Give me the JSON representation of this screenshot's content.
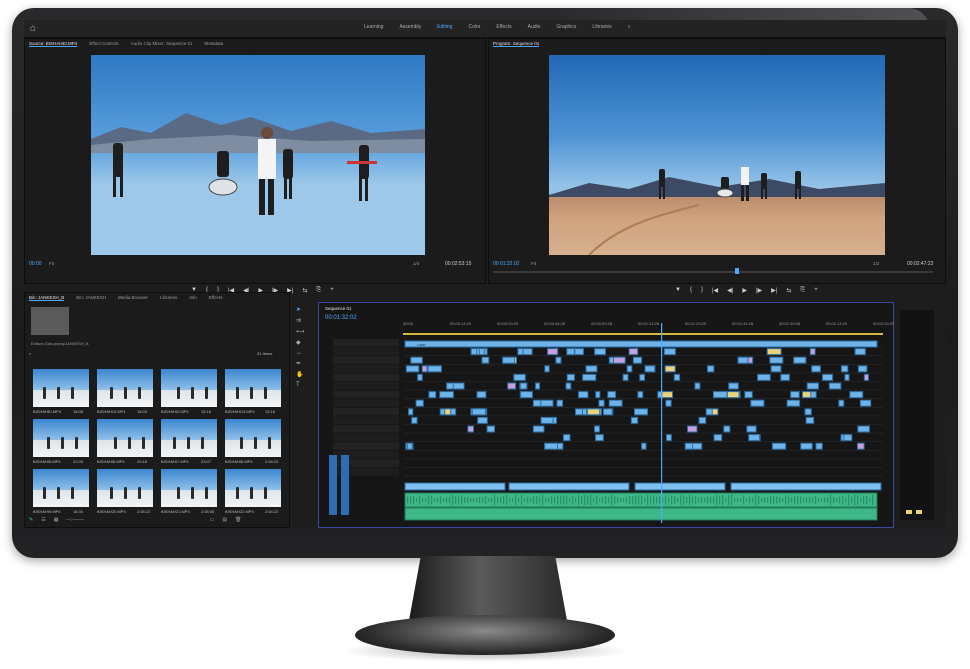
{
  "topbar": {
    "workspaces": [
      "Learning",
      "Assembly",
      "Editing",
      "Color",
      "Effects",
      "Audio",
      "Graphics",
      "Libraries"
    ],
    "more": "»"
  },
  "source_panel": {
    "tabs": [
      "Source: BISHAHEI.MP4",
      "Effect Controls",
      "Audio Clip Mixer: Sequence 01",
      "Metadata"
    ],
    "timecode_left": "00:00",
    "fit": "Fit",
    "scale": "1/4",
    "timecode_right": "00:02:53:15"
  },
  "program_panel": {
    "tabs": [
      "Program: Sequence 01"
    ],
    "timecode_left": "00:01:32:02",
    "fit": "Fit",
    "scale": "1/2",
    "timecode_right": "00:02:47:23"
  },
  "transport": [
    "▼",
    "{",
    "}",
    "|◀",
    "◀|",
    "▶",
    "|▶",
    "▶|",
    "⇆",
    "⎘",
    "+"
  ],
  "project_panel": {
    "tabs": [
      "Bin: JANKESH_B",
      "Bin: JANKESH",
      "Media Browser",
      "Libraries",
      "Info",
      "Effects"
    ],
    "path": "Editors Gals.prproj\\JANKESH_B",
    "items_count": "31 Items",
    "thumbs": [
      {
        "name": "BISHAHEI.MP4",
        "dur": "18:08"
      },
      {
        "name": "BISHAHOI.MP4",
        "dur": "18:03"
      },
      {
        "name": "BISHAHI2.MP4",
        "dur": "15:18"
      },
      {
        "name": "BISHAHO4.MP4",
        "dur": "19:18"
      },
      {
        "name": "BISHAHI5.MP4",
        "dur": "22:09"
      },
      {
        "name": "BISHAHI6.MP4",
        "dur": "20:18"
      },
      {
        "name": "BISHAHI7.MP4",
        "dur": "23:07"
      },
      {
        "name": "BISHAHI8.MP4",
        "dur": "2:54:22"
      },
      {
        "name": "BISHAHI9.MP4",
        "dur": "18:30"
      },
      {
        "name": "BISHAH20.MP4",
        "dur": "2:55:22"
      },
      {
        "name": "BISHAH21.MP4",
        "dur": "2:55:55"
      },
      {
        "name": "BISHAH22.MP4",
        "dur": "2:54:22"
      }
    ]
  },
  "timeline": {
    "title": "Sequence 01",
    "timecode": "00:01:32:02",
    "ruler": [
      "00:00",
      "00:00:14:29",
      "00:00:29:29",
      "00:00:44:28",
      "00:00:59:28",
      "00:01:14:28",
      "00:01:29:29",
      "00:01:44:28",
      "00:01:59:28",
      "00:02:14:29",
      "00:02:29:29"
    ],
    "track_label": "Layer"
  }
}
